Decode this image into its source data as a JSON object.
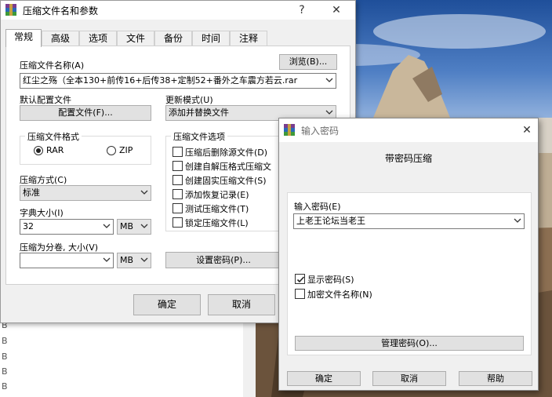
{
  "background": {
    "left_list_rows": [
      "B",
      "B",
      "B",
      "B",
      "B",
      "B"
    ]
  },
  "main_dialog": {
    "title": "压缩文件名和参数",
    "help_glyph": "?",
    "close_glyph": "✕",
    "tabs": [
      "常规",
      "高级",
      "选项",
      "文件",
      "备份",
      "时间",
      "注释"
    ],
    "archive_name_label": "压缩文件名称(A)",
    "browse_button": "浏览(B)...",
    "archive_name_value": "红尘之殇（全本130+前传16+后传38+定制52+番外之车震方若云.rar",
    "default_profile_label": "默认配置文件",
    "profile_button": "配置文件(F)...",
    "update_mode_label": "更新模式(U)",
    "update_mode_value": "添加并替换文件",
    "format_group_title": "压缩文件格式",
    "format_rar": "RAR",
    "format_zip": "ZIP",
    "options_group_title": "压缩文件选项",
    "options": [
      "压缩后删除源文件(D)",
      "创建自解压格式压缩文",
      "创建固实压缩文件(S)",
      "添加恢复记录(E)",
      "测试压缩文件(T)",
      "锁定压缩文件(L)"
    ],
    "method_label": "压缩方式(C)",
    "method_value": "标准",
    "dict_label": "字典大小(I)",
    "dict_value": "32",
    "dict_unit": "MB",
    "split_label": "压缩为分卷, 大小(V)",
    "split_value": "",
    "split_unit": "MB",
    "set_password_button": "设置密码(P)...",
    "ok_button": "确定",
    "cancel_button": "取消"
  },
  "password_dialog": {
    "title": "输入密码",
    "close_glyph": "✕",
    "heading": "带密码压缩",
    "enter_label": "输入密码(E)",
    "password_value": "上老王论坛当老王",
    "show_password_label": "显示密码(S)",
    "show_password_checked": true,
    "encrypt_names_label": "加密文件名称(N)",
    "encrypt_names_checked": false,
    "manage_button": "管理密码(O)...",
    "ok_button": "确定",
    "cancel_button": "取消",
    "help_button": "帮助"
  }
}
